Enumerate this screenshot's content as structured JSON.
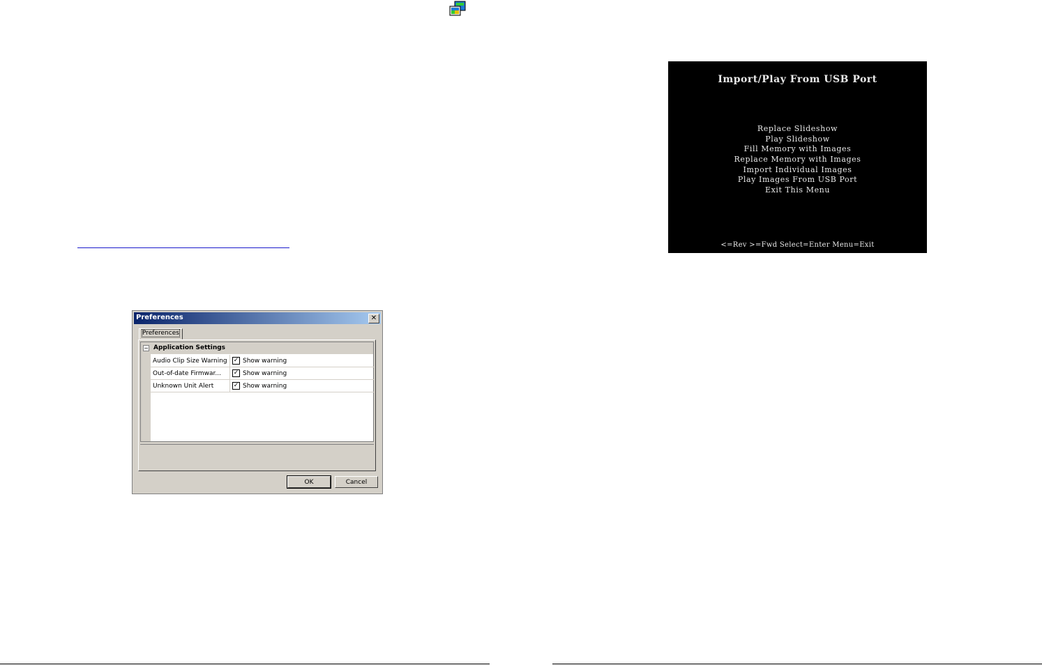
{
  "preferences_dialog": {
    "title": "Preferences",
    "close_glyph": "✕",
    "tab_label": "Preferences",
    "category": {
      "toggle_glyph": "−",
      "label": "Application Settings"
    },
    "properties": [
      {
        "name": "Audio Clip Size Warning",
        "value": "Show warning",
        "checked": true
      },
      {
        "name": "Out-of-date Firmwar...",
        "value": "Show warning",
        "checked": true
      },
      {
        "name": "Unknown Unit Alert",
        "value": "Show warning",
        "checked": true
      }
    ],
    "check_glyph": "✓",
    "ok_label": "OK",
    "cancel_label": "Cancel"
  },
  "tv_screen": {
    "title": "Import/Play From USB Port",
    "menu_items": [
      "Replace Slideshow",
      "Play Slideshow",
      "Fill Memory with Images",
      "Replace Memory with Images",
      "Import Individual Images",
      "Play Images From USB Port",
      "Exit This Menu"
    ],
    "footer": "<=Rev >=Fwd Select=Enter Menu=Exit"
  },
  "icons": {
    "app_icon": "slideshow-app-icon"
  },
  "colors": {
    "titlebar_start": "#0a246a",
    "titlebar_end": "#a6caf0",
    "dialog_face": "#d4d0c8",
    "link": "#1a1acc",
    "tv_background": "#000000"
  }
}
